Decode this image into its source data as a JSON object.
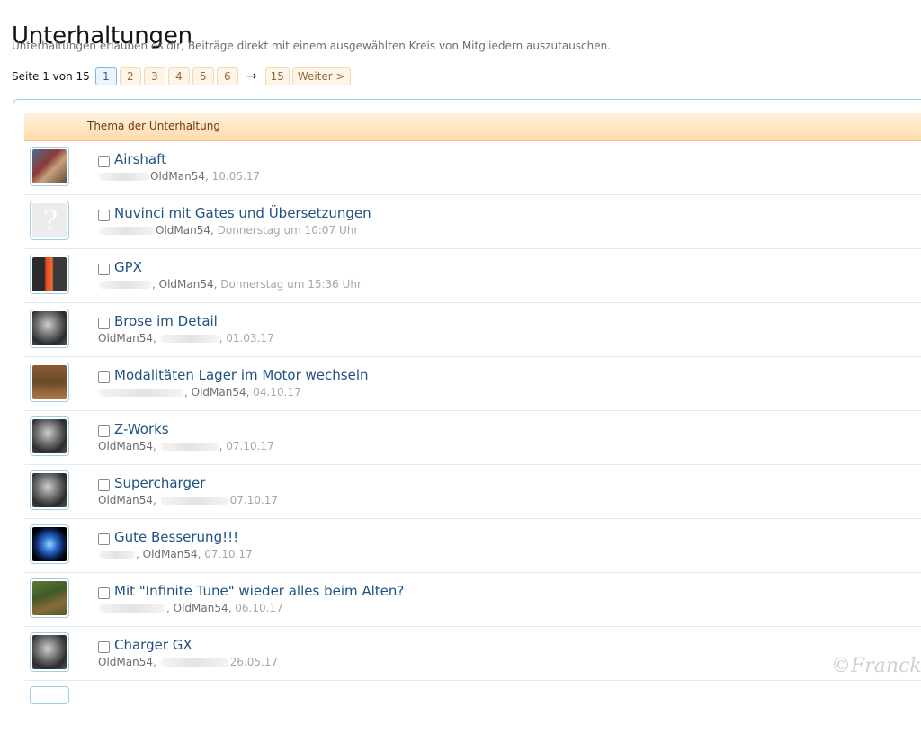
{
  "page": {
    "title": "Unterhaltungen",
    "description": "Unterhaltungen erlauben es dir, Beiträge direkt mit einem ausgewählten Kreis von Mitgliedern auszutauschen."
  },
  "pagination": {
    "label": "Seite 1 von 15",
    "pages": [
      "1",
      "2",
      "3",
      "4",
      "5",
      "6"
    ],
    "current": "1",
    "arrow": "→",
    "last": "15",
    "next": "Weiter >"
  },
  "table": {
    "header": "Thema der Unterhaltung",
    "rows": [
      {
        "title": "Airshaft",
        "pre": "",
        "user": "OldMan54",
        "post": "",
        "date": "10.05.17",
        "avatar": "avatar-photo"
      },
      {
        "title": "Nuvinci mit Gates und Übersetzungen",
        "pre": "",
        "user": "OldMan54",
        "post": "",
        "date": "Donnerstag um 10:07 Uhr",
        "avatar": "avatar-placeholder"
      },
      {
        "title": "GPX",
        "pre": "",
        "user": "OldMan54",
        "post": "",
        "date": "Donnerstag um 15:36 Uhr",
        "avatar": "avatar-photo"
      },
      {
        "title": "Brose im Detail",
        "pre": "OldMan54",
        "user": "",
        "post": "",
        "date": "01.03.17",
        "avatar": "avatar-photo"
      },
      {
        "title": "Modalitäten Lager im Motor wechseln",
        "pre": "",
        "user": "OldMan54",
        "post": "",
        "date": "04.10.17",
        "avatar": "avatar-photo"
      },
      {
        "title": "Z-Works",
        "pre": "OldMan54",
        "user": "",
        "post": "",
        "date": "07.10.17",
        "avatar": "avatar-photo"
      },
      {
        "title": "Supercharger",
        "pre": "OldMan54",
        "user": "",
        "post": "",
        "date": "07.10.17",
        "avatar": "avatar-photo"
      },
      {
        "title": "Gute Besserung!!!",
        "pre": "",
        "user": "OldMan54",
        "post": "",
        "date": "07.10.17",
        "avatar": "avatar-photo"
      },
      {
        "title": "Mit \"Infinite Tune\" wieder alles beim Alten?",
        "pre": "",
        "user": "OldMan54",
        "post": "",
        "date": "06.10.17",
        "avatar": "avatar-photo"
      },
      {
        "title": "Charger GX",
        "pre": "OldMan54",
        "user": "",
        "post": "",
        "date": "26.05.17",
        "avatar": "avatar-photo"
      }
    ]
  },
  "watermark": "©Franck"
}
